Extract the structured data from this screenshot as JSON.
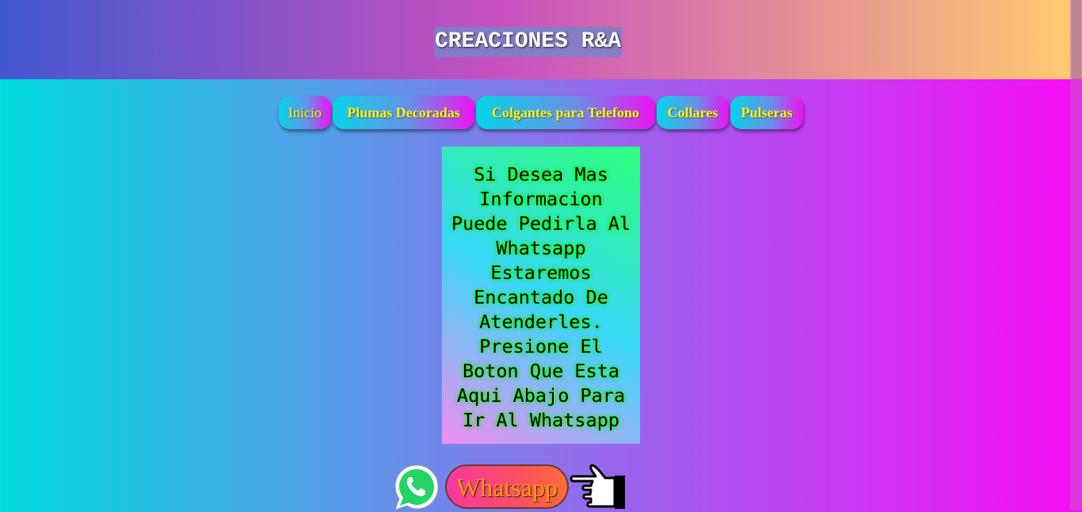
{
  "header": {
    "title": "CREACIONES R&A"
  },
  "nav": {
    "items": [
      {
        "label": "Inicio"
      },
      {
        "label": "Plumas Decoradas"
      },
      {
        "label": "Colgantes para Telefono"
      },
      {
        "label": "Collares"
      },
      {
        "label": "Pulseras"
      }
    ]
  },
  "info": {
    "lines": [
      "Si Desea Mas",
      "Informacion",
      "Puede Pedirla Al",
      "Whatsapp",
      "Estaremos",
      "Encantado De",
      "Atenderles.",
      "Presione El",
      "Boton Que Esta",
      "Aqui Abajo Para",
      "Ir Al Whatsapp"
    ]
  },
  "whatsapp": {
    "button_label": "Whatsapp",
    "logo_icon": "whatsapp-icon",
    "pointer_icon": "pointing-hand-icon"
  },
  "colors": {
    "header_start": "#4158d0",
    "header_mid": "#c850c0",
    "header_end": "#ffcc70",
    "nav_text": "#f7f51d",
    "whatsapp_green": "#25d366"
  }
}
